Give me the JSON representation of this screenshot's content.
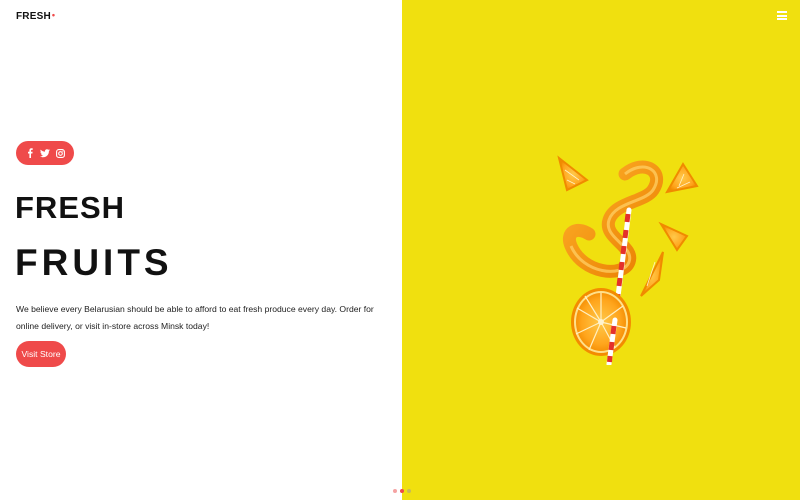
{
  "brand": {
    "name": "FRESH",
    "mark": "•",
    "accent": "#ef4a4a"
  },
  "nav": {
    "menu_icon": "hamburger-icon"
  },
  "social": {
    "icons": [
      "facebook-icon",
      "twitter-icon",
      "instagram-icon"
    ]
  },
  "hero": {
    "title_line1": "FRESH",
    "title_line2": "FRUITS",
    "description": "We believe every Belarusian should be able to afford to eat fresh produce every day. Order for online delivery, or visit in-store across Minsk today!",
    "cta_label": "Visit Store",
    "image": "orange-slices-with-straw"
  },
  "colors": {
    "panel_right": "#f0e00f",
    "accent": "#ef4a4a",
    "text": "#111111"
  },
  "pagination": {
    "count": 3,
    "active": 1,
    "colors": [
      "#f5a3a3",
      "#ef4a4a",
      "#c6b95a"
    ]
  }
}
